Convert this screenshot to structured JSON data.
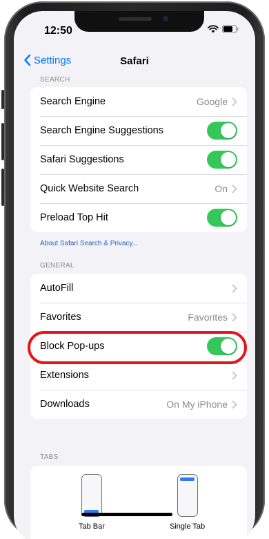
{
  "status_bar": {
    "time": "12:50"
  },
  "nav": {
    "back_label": "Settings",
    "title": "Safari"
  },
  "search_section": {
    "header": "SEARCH",
    "rows": [
      {
        "label": "Search Engine",
        "value": "Google",
        "control": "chevron"
      },
      {
        "label": "Search Engine Suggestions",
        "control": "toggle",
        "on": true
      },
      {
        "label": "Safari Suggestions",
        "control": "toggle",
        "on": true
      },
      {
        "label": "Quick Website Search",
        "value": "On",
        "control": "chevron"
      },
      {
        "label": "Preload Top Hit",
        "control": "toggle",
        "on": true
      }
    ],
    "footer_link": "About Safari Search & Privacy..."
  },
  "general_section": {
    "header": "GENERAL",
    "rows": [
      {
        "label": "AutoFill",
        "control": "chevron"
      },
      {
        "label": "Favorites",
        "value": "Favorites",
        "control": "chevron"
      },
      {
        "label": "Block Pop-ups",
        "control": "toggle",
        "on": true
      },
      {
        "label": "Extensions",
        "control": "chevron"
      },
      {
        "label": "Downloads",
        "value": "On My iPhone",
        "control": "chevron"
      }
    ]
  },
  "tabs_section": {
    "header": "TABS",
    "options": [
      {
        "caption": "Tab Bar"
      },
      {
        "caption": "Single Tab"
      }
    ]
  },
  "colors": {
    "accent": "#007aff",
    "toggle_on": "#34c759",
    "highlight": "#e3151a",
    "background": "#f2f2f7"
  },
  "icons": {
    "back": "chevron-left-icon",
    "disclosure": "chevron-right-icon",
    "wifi": "wifi-icon",
    "battery": "battery-icon"
  }
}
